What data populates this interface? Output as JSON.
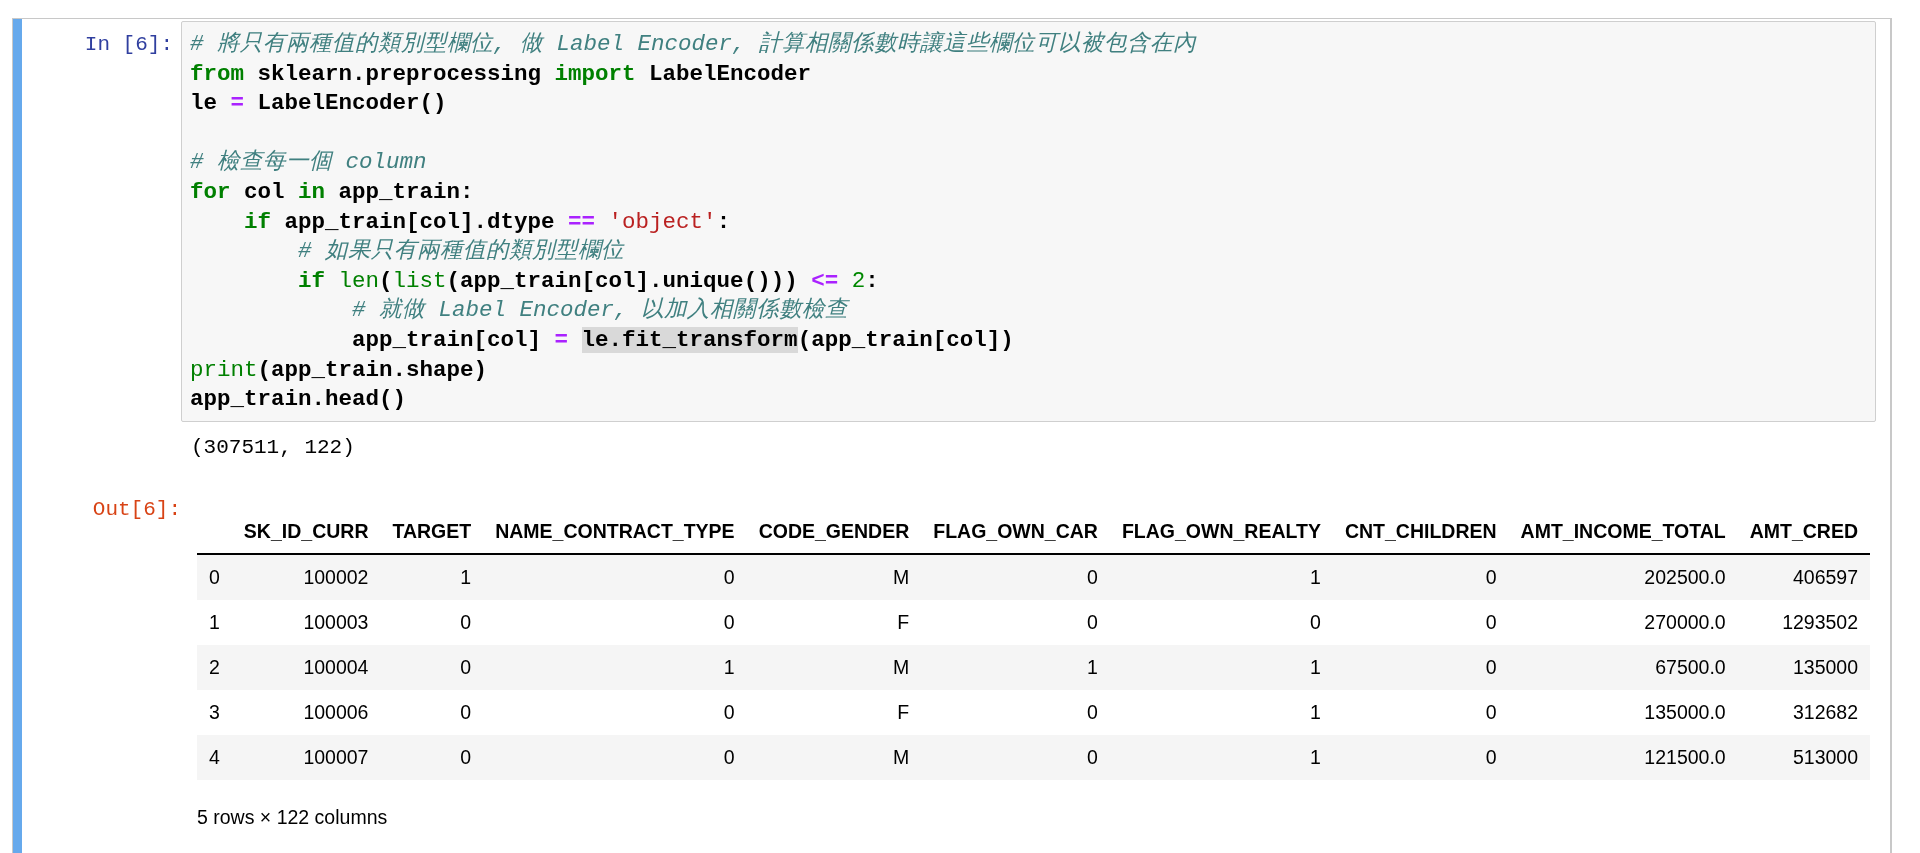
{
  "cell": {
    "in_prompt": "In [6]:",
    "code_lines": [
      {
        "kind": "code",
        "tokens": [
          {
            "text": "# 將只有兩種值的類別型欄位, 做 Label Encoder, 計算相關係數時讓這些欄位可以被包含在內",
            "kind": "comment"
          }
        ]
      },
      {
        "kind": "code",
        "tokens": [
          {
            "text": "from",
            "kind": "keyword"
          },
          {
            "text": " sklearn.preprocessing ",
            "kind": "plain"
          },
          {
            "text": "import",
            "kind": "keyword"
          },
          {
            "text": " LabelEncoder",
            "kind": "plain"
          }
        ]
      },
      {
        "kind": "code",
        "tokens": [
          {
            "text": "le ",
            "kind": "plain"
          },
          {
            "text": "=",
            "kind": "operator"
          },
          {
            "text": " LabelEncoder()",
            "kind": "plain"
          }
        ]
      },
      {
        "kind": "blank"
      },
      {
        "kind": "code",
        "tokens": [
          {
            "text": "# 檢查每一個 column",
            "kind": "comment"
          }
        ]
      },
      {
        "kind": "code",
        "tokens": [
          {
            "text": "for",
            "kind": "keyword"
          },
          {
            "text": " col ",
            "kind": "plain"
          },
          {
            "text": "in",
            "kind": "keyword"
          },
          {
            "text": " app_train:",
            "kind": "plain"
          }
        ]
      },
      {
        "kind": "code",
        "tokens": [
          {
            "text": "    if",
            "kind": "keyword"
          },
          {
            "text": " app_train[col].dtype ",
            "kind": "plain"
          },
          {
            "text": "==",
            "kind": "operator"
          },
          {
            "text": " 'object'",
            "kind": "string"
          },
          {
            "text": ":",
            "kind": "plain"
          }
        ]
      },
      {
        "kind": "code",
        "tokens": [
          {
            "text": "        # 如果只有兩種值的類別型欄位",
            "kind": "comment"
          }
        ]
      },
      {
        "kind": "code",
        "tokens": [
          {
            "text": "        if",
            "kind": "keyword"
          },
          {
            "text": " len",
            "kind": "builtin"
          },
          {
            "text": "(",
            "kind": "plain"
          },
          {
            "text": "list",
            "kind": "builtin"
          },
          {
            "text": "(app_train[col].unique())) ",
            "kind": "plain"
          },
          {
            "text": "<=",
            "kind": "operator"
          },
          {
            "text": " 2",
            "kind": "number"
          },
          {
            "text": ":",
            "kind": "plain"
          }
        ]
      },
      {
        "kind": "code",
        "tokens": [
          {
            "text": "            # 就做 Label Encoder, 以加入相關係數檢查",
            "kind": "comment"
          }
        ]
      },
      {
        "kind": "code",
        "tokens": [
          {
            "text": "            app_train[col] ",
            "kind": "plain"
          },
          {
            "text": "= ",
            "kind": "operator"
          },
          {
            "text": "le.fit_transform",
            "kind": "highlight"
          },
          {
            "text": "(app_train[col])",
            "kind": "plain"
          }
        ]
      },
      {
        "kind": "code",
        "tokens": [
          {
            "text": "print",
            "kind": "builtin"
          },
          {
            "text": "(app_train.shape)",
            "kind": "plain"
          }
        ]
      },
      {
        "kind": "code",
        "tokens": [
          {
            "text": "app_train.head()",
            "kind": "plain"
          }
        ]
      }
    ],
    "stdout": "(307511, 122)",
    "out_prompt": "Out[6]:",
    "table": {
      "columns": [
        "SK_ID_CURR",
        "TARGET",
        "NAME_CONTRACT_TYPE",
        "CODE_GENDER",
        "FLAG_OWN_CAR",
        "FLAG_OWN_REALTY",
        "CNT_CHILDREN",
        "AMT_INCOME_TOTAL",
        "AMT_CRED"
      ],
      "rows": [
        {
          "index": "0",
          "cells": [
            "100002",
            "1",
            "0",
            "M",
            "0",
            "1",
            "0",
            "202500.0",
            "406597"
          ]
        },
        {
          "index": "1",
          "cells": [
            "100003",
            "0",
            "0",
            "F",
            "0",
            "0",
            "0",
            "270000.0",
            "1293502"
          ]
        },
        {
          "index": "2",
          "cells": [
            "100004",
            "0",
            "1",
            "M",
            "1",
            "1",
            "0",
            "67500.0",
            "135000"
          ]
        },
        {
          "index": "3",
          "cells": [
            "100006",
            "0",
            "0",
            "F",
            "0",
            "1",
            "0",
            "135000.0",
            "312682"
          ]
        },
        {
          "index": "4",
          "cells": [
            "100007",
            "0",
            "0",
            "M",
            "0",
            "1",
            "0",
            "121500.0",
            "513000"
          ]
        }
      ]
    },
    "footer": "5 rows × 122 columns"
  }
}
